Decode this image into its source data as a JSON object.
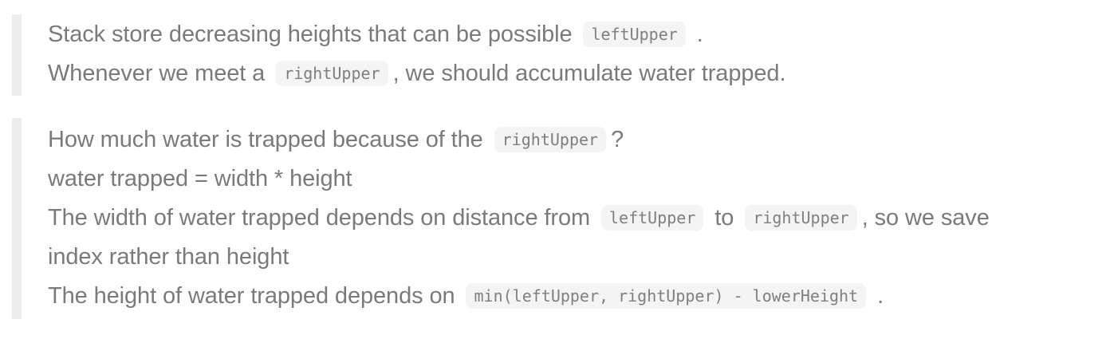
{
  "blocks": [
    {
      "lines": [
        {
          "before": "Stack store decreasing heights that can be possible",
          "code": "leftUpper",
          "after": "."
        },
        {
          "before": "Whenever we meet a",
          "code": "rightUpper",
          "after": ", we should accumulate water trapped."
        }
      ]
    },
    {
      "lines": [
        {
          "before": "How much water is trapped because of the",
          "code": "rightUpper",
          "after": "?"
        },
        {
          "text": "water trapped = width * height"
        },
        {
          "before": "The width of water trapped depends on distance from",
          "code1": "leftUpper",
          "middle": "to",
          "code2": "rightUpper",
          "after": ", so we save"
        },
        {
          "text": "index rather than height"
        },
        {
          "before": "The height of water trapped depends on",
          "code": "min(leftUpper, rightUpper) - lowerHeight",
          "after": "."
        }
      ]
    }
  ]
}
